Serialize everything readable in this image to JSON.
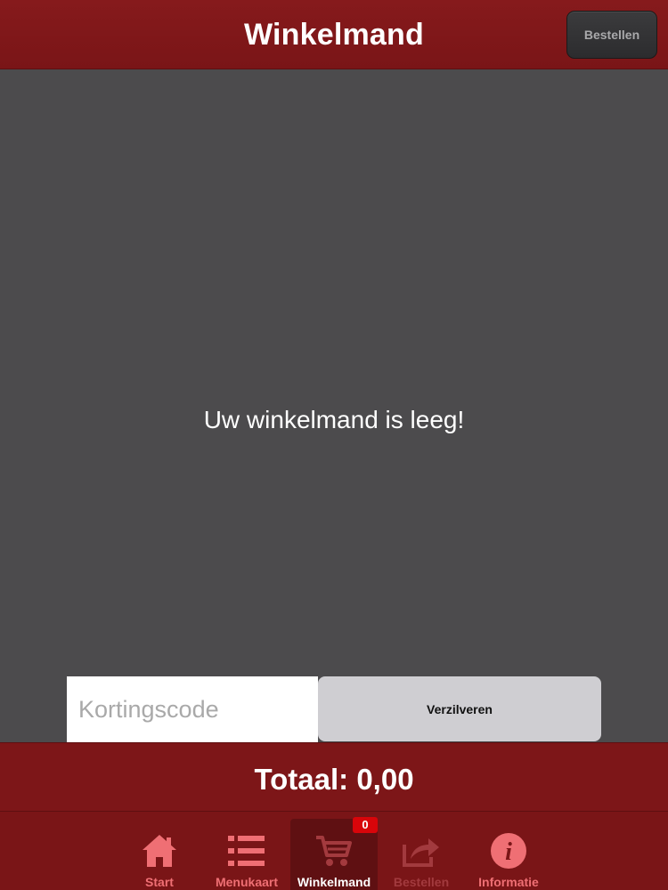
{
  "header": {
    "title": "Winkelmand",
    "order_button": "Bestellen"
  },
  "cart": {
    "empty_message": "Uw winkelmand is leeg!"
  },
  "coupon": {
    "placeholder": "Kortingscode",
    "value": "",
    "redeem_button": "Verzilveren"
  },
  "total": {
    "label": "Totaal: 0,00"
  },
  "tabbar": {
    "items": [
      {
        "label": "Start",
        "icon": "home-icon"
      },
      {
        "label": "Menukaart",
        "icon": "list-icon"
      },
      {
        "label": "Winkelmand",
        "icon": "cart-icon",
        "badge": "0",
        "active": true
      },
      {
        "label": "Bestellen",
        "icon": "share-icon",
        "disabled": true
      },
      {
        "label": "Informatie",
        "icon": "info-icon"
      }
    ]
  },
  "colors": {
    "brand_red": "#7a1517",
    "tab_text": "#ef6f74",
    "badge_red": "#d8050a",
    "content_bg": "#4c4b4d"
  }
}
